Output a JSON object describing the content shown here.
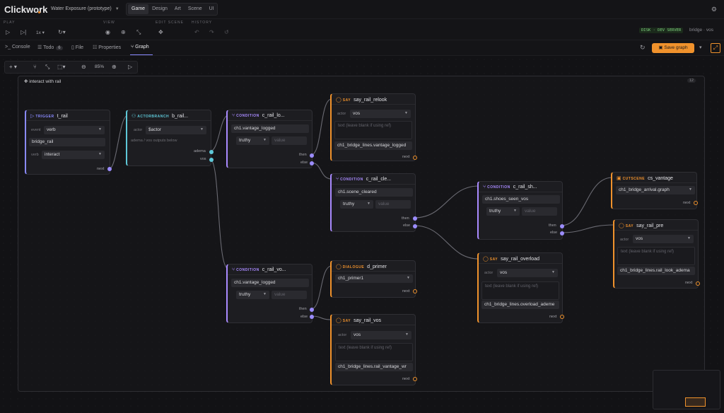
{
  "app": {
    "name": "Clickwork",
    "project": "Water Exposure (prototype)"
  },
  "modes": [
    "Game",
    "Design",
    "Art",
    "Scene",
    "UI"
  ],
  "toolbar": {
    "sections": [
      "PLAY",
      "VIEW",
      "EDIT SCENE",
      "HISTORY"
    ],
    "speed": "1x",
    "server": "DISK · DEV SERVER",
    "branch": "bridge · vos"
  },
  "tabs": {
    "console": "Console",
    "todo": "Todo",
    "todo_count": "6",
    "file": "File",
    "properties": "Properties",
    "graph": "Graph"
  },
  "actions": {
    "save": "Save graph"
  },
  "graph_toolbar": {
    "add": "+",
    "zoom": "85%"
  },
  "group": {
    "title": "interact with rail",
    "count": "12"
  },
  "labels": {
    "trigger": "TRIGGER",
    "actorbranch": "ACTORBRANCH",
    "condition": "CONDITION",
    "say": "SAY",
    "dialogue": "DIALOGUE",
    "cutscene": "CUTSCENE",
    "event": "event",
    "verb": "verb",
    "actor": "actor",
    "next": "next",
    "then": "then",
    "else": "else",
    "adema": "adema",
    "vos": "vos",
    "value_ph": "value",
    "text_ph": "text (leave blank if using ref)",
    "branch_hint": "adema / vos outputs below"
  },
  "nodes": {
    "t_rail": {
      "name": "t_rail",
      "event": "verb",
      "object": "bridge_rail",
      "verb": "interact"
    },
    "b_rail": {
      "name": "b_rail...",
      "actor": "$actor"
    },
    "c_rail_lo": {
      "name": "c_rail_lo...",
      "expr": "ch1.vantage_logged",
      "op": "truthy"
    },
    "c_rail_vo": {
      "name": "c_rail_vo...",
      "expr": "ch1.vantage_logged",
      "op": "truthy"
    },
    "say_rail_relook": {
      "name": "say_rail_relook",
      "actor": "vos",
      "ref": "ch1_bridge_lines.vantage_logged"
    },
    "c_rail_cle": {
      "name": "c_rail_cle...",
      "expr": "ch1.scene_cleared",
      "op": "truthy"
    },
    "d_primer": {
      "name": "d_primer",
      "dialogue": "ch1_primer1"
    },
    "say_rail_vos": {
      "name": "say_rail_vos",
      "actor": "vos",
      "ref": "ch1_bridge_lines.rail_vantage_wr"
    },
    "c_rail_sh": {
      "name": "c_rail_sh...",
      "expr": "ch1.shoes_seen_vos",
      "op": "truthy"
    },
    "say_rail_overload": {
      "name": "say_rail_overload",
      "actor": "vos",
      "ref": "ch1_bridge_lines.overload_ademe"
    },
    "cs_vantage": {
      "name": "cs_vantage",
      "graph": "ch1_bridge_arrival.graph"
    },
    "say_rail_pre": {
      "name": "say_rail_pre",
      "actor": "vos",
      "ref": "ch1_bridge_lines.rail_look_adema"
    }
  },
  "colors": {
    "accent": "#f0922c",
    "trigger": "#8a8aff",
    "condition": "#a98aff",
    "actor": "#5ec8d8",
    "edge": "#6a6a72"
  }
}
